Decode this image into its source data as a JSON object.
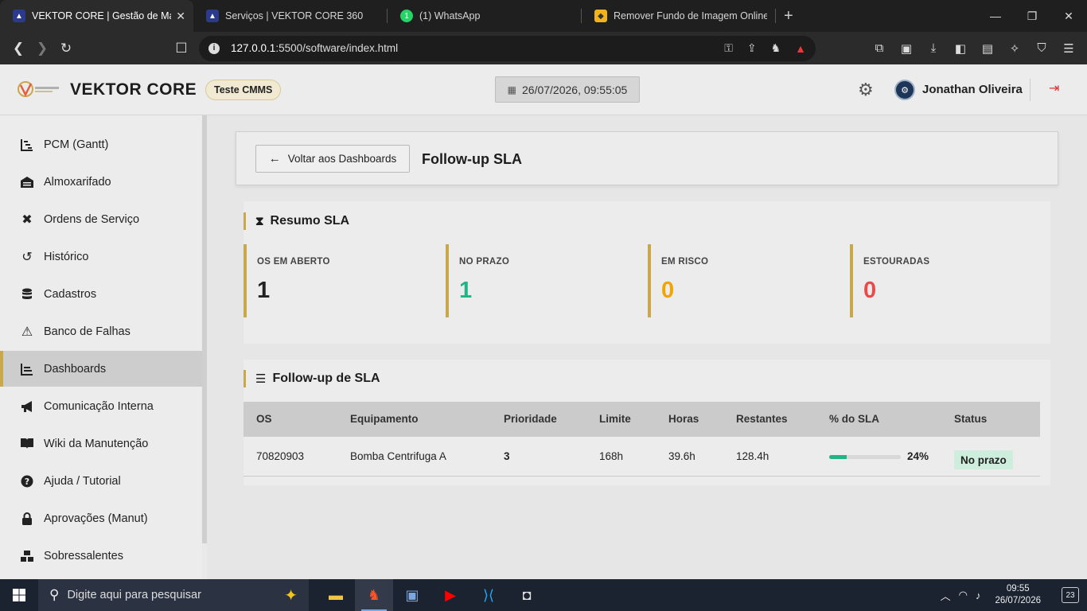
{
  "browser": {
    "tabs": [
      {
        "title": "VEKTOR CORE | Gestão de Manut",
        "active": true
      },
      {
        "title": "Serviços | VEKTOR CORE 360",
        "active": false
      },
      {
        "title": "(1) WhatsApp",
        "active": false,
        "badge": "1"
      },
      {
        "title": "Remover Fundo de Imagem Online G",
        "active": false
      }
    ],
    "url_host": "127.0.0.1",
    "url_path": ":5500/software/index.html"
  },
  "header": {
    "brand": "VEKTOR CORE",
    "env_label": "Teste CMMS",
    "datetime": "26/07/2026, 09:55:05",
    "user_name": "Jonathan Oliveira"
  },
  "sidebar": {
    "items": [
      {
        "label": "PCM (Gantt)",
        "icon": "gantt-chart-icon"
      },
      {
        "label": "Almoxarifado",
        "icon": "warehouse-icon"
      },
      {
        "label": "Ordens de Serviço",
        "icon": "tools-icon"
      },
      {
        "label": "Histórico",
        "icon": "history-icon"
      },
      {
        "label": "Cadastros",
        "icon": "database-icon"
      },
      {
        "label": "Banco de Falhas",
        "icon": "warning-icon"
      },
      {
        "label": "Dashboards",
        "icon": "chart-line-icon",
        "active": true
      },
      {
        "label": "Comunicação Interna",
        "icon": "megaphone-icon"
      },
      {
        "label": "Wiki da Manutenção",
        "icon": "book-icon"
      },
      {
        "label": "Ajuda / Tutorial",
        "icon": "help-icon"
      },
      {
        "label": "Aprovações (Manut)",
        "icon": "lock-icon"
      },
      {
        "label": "Sobressalentes",
        "icon": "boxes-icon"
      }
    ]
  },
  "page": {
    "back_label": "Voltar aos Dashboards",
    "title": "Follow-up SLA"
  },
  "summary": {
    "title": "Resumo SLA",
    "kpis": [
      {
        "label": "OS EM ABERTO",
        "value": "1",
        "color": "#222222"
      },
      {
        "label": "NO PRAZO",
        "value": "1",
        "color": "#20b486"
      },
      {
        "label": "EM RISCO",
        "value": "0",
        "color": "#f0a500"
      },
      {
        "label": "ESTOURADAS",
        "value": "0",
        "color": "#e84b4b"
      }
    ]
  },
  "followup": {
    "title": "Follow-up de SLA",
    "columns": [
      "OS",
      "Equipamento",
      "Prioridade",
      "Limite",
      "Horas",
      "Restantes",
      "% do SLA",
      "Status"
    ],
    "rows": [
      {
        "os": "70820903",
        "equipamento": "Bomba Centrifuga A",
        "prioridade": "3",
        "limite": "168h",
        "horas": "39.6h",
        "restantes": "128.4h",
        "sla_pct": "24%",
        "sla_fraction": 0.24,
        "status": "No prazo"
      }
    ]
  },
  "taskbar": {
    "search_placeholder": "Digite aqui para pesquisar",
    "time": "09:55",
    "date": "26/07/2026",
    "notifications": "23"
  }
}
